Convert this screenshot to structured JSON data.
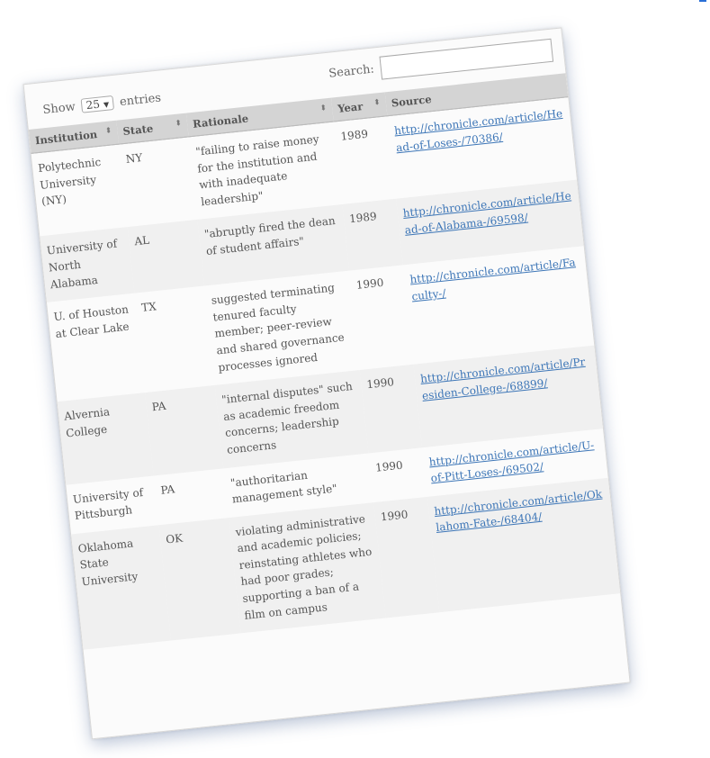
{
  "controls": {
    "show_label": "Show",
    "length_value": "25",
    "entries_label": "entries",
    "search_label": "Search:",
    "search_value": ""
  },
  "table": {
    "headers": [
      "Institution",
      "State",
      "Rationale",
      "Year",
      "Source"
    ],
    "rows": [
      {
        "institution": "Polytechnic University (NY)",
        "state": "NY",
        "rationale": "\"failing to raise money for the institution and with inadequate leadership\"",
        "year": "1989",
        "source": "http://chronicle.com/article/Head-of-Loses-/70386/"
      },
      {
        "institution": "University of North Alabama",
        "state": "AL",
        "rationale": "\"abruptly fired the dean of student affairs\"",
        "year": "1989",
        "source": "http://chronicle.com/article/Head-of-Alabama-/69598/"
      },
      {
        "institution": "U. of Houston at Clear Lake",
        "state": "TX",
        "rationale": "suggested terminating tenured faculty member; peer-review and shared governance processes ignored",
        "year": "1990",
        "source": "http://chronicle.com/article/Faculty-/"
      },
      {
        "institution": "Alvernia College",
        "state": "PA",
        "rationale": "\"internal disputes\" such as academic freedom concerns; leadership concerns",
        "year": "1990",
        "source": "http://chronicle.com/article/Presiden-College-/68899/"
      },
      {
        "institution": "University of Pittsburgh",
        "state": "PA",
        "rationale": "\"authoritarian management style\"",
        "year": "1990",
        "source": "http://chronicle.com/article/U-of-Pitt-Loses-/69502/"
      },
      {
        "institution": "Oklahoma State University",
        "state": "OK",
        "rationale": "violating administrative and academic policies; reinstating athletes who had poor grades; supporting a ban of a film on campus",
        "year": "1990",
        "source": "http://chronicle.com/article/Oklahom-Fate-/68404/"
      }
    ]
  }
}
